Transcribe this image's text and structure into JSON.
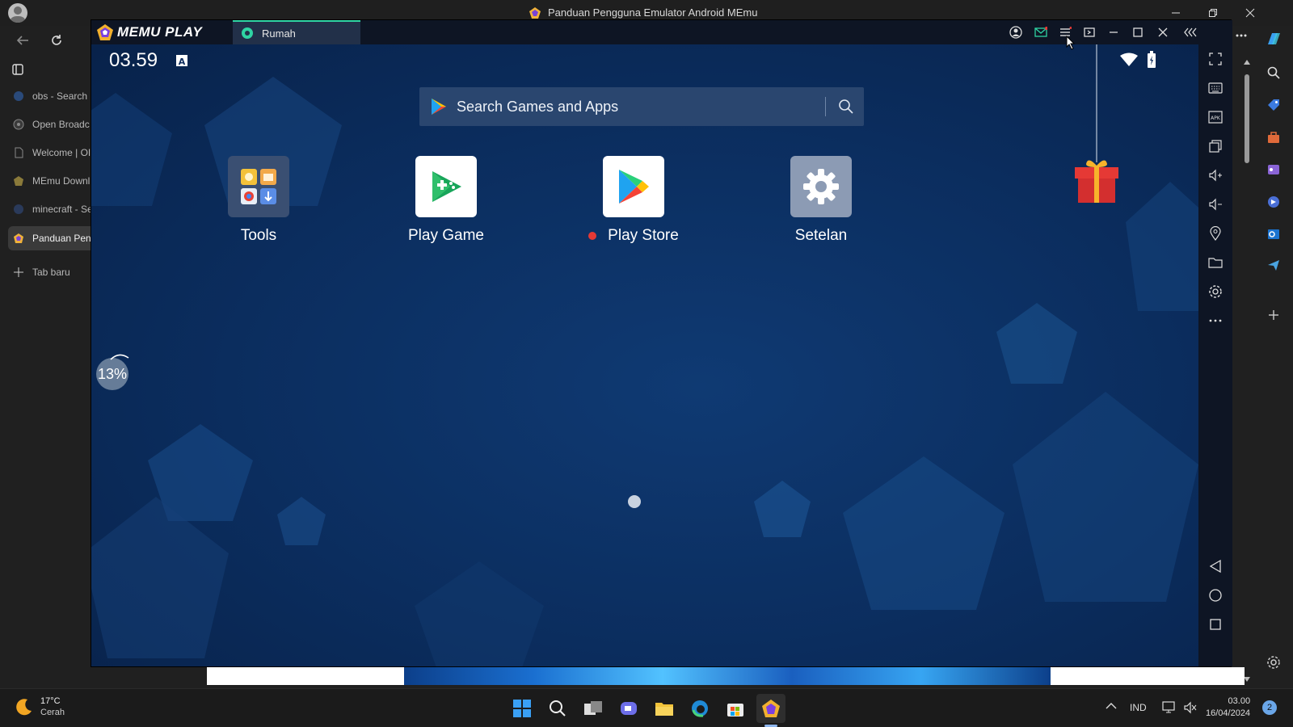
{
  "browser": {
    "window_title": "Panduan Pengguna Emulator Android MEmu",
    "tabs": [
      {
        "label": "obs - Search"
      },
      {
        "label": "Open Broadc"
      },
      {
        "label": "Welcome | OI"
      },
      {
        "label": "MEmu Downl"
      },
      {
        "label": "minecraft - Se"
      },
      {
        "label": "Panduan Peng"
      }
    ],
    "new_tab_label": "Tab baru"
  },
  "memu": {
    "logo_text": "MEMU PLAY",
    "tab_label": "Rumah",
    "status_time": "03.59",
    "search_placeholder": "Search Games and Apps",
    "apps": [
      {
        "label": "Tools"
      },
      {
        "label": "Play Game"
      },
      {
        "label": "Play Store"
      },
      {
        "label": "Setelan"
      }
    ],
    "progress_percent": "13%"
  },
  "taskbar": {
    "temperature": "17°C",
    "weather": "Cerah",
    "language": "IND",
    "time": "03.00",
    "date": "16/04/2024",
    "notification_count": "2"
  },
  "colors": {
    "accent_green": "#2fd4a3",
    "android_bg": "#0d2b5c",
    "gift_red": "#e53935"
  }
}
